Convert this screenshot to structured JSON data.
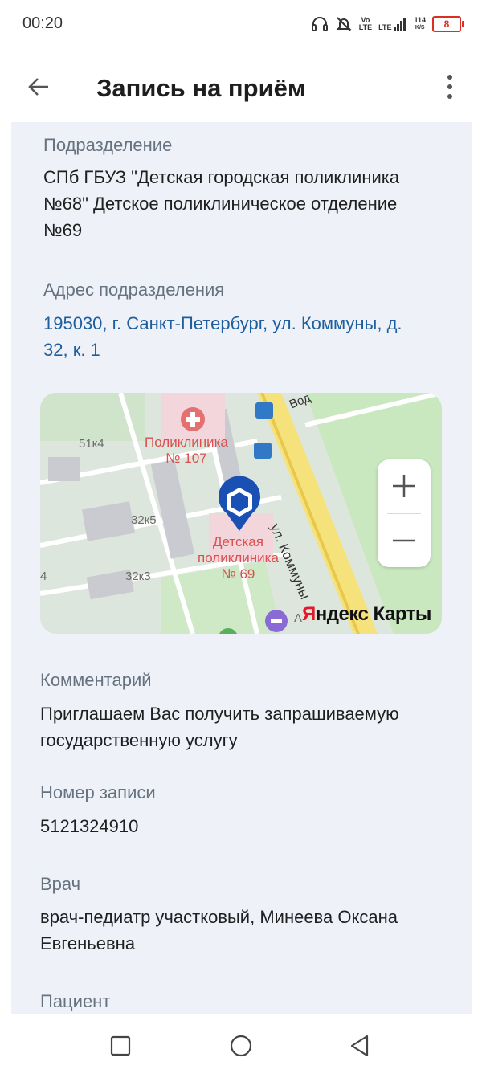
{
  "status_bar": {
    "time": "00:20",
    "net_vo": "Vo",
    "net_lte_top": "LTE",
    "net_lte_1": "LTE",
    "speed_value": "114",
    "speed_unit": "K/S",
    "battery": "8"
  },
  "app_bar": {
    "title": "Запись на приём"
  },
  "details": {
    "division_label": "Подразделение",
    "division_value_lines": [
      "СПб ГБУЗ \"Детская городская поликлиника",
      "№68\" Детское поликлиническое отделение",
      "№69"
    ],
    "address_label": "Адрес подразделения",
    "address_lines": [
      "195030, г. Санкт-Петербург, ул. Коммуны, д.",
      "32, к. 1"
    ],
    "comment_label": "Комментарий",
    "comment_lines": [
      "Приглашаем Вас получить запрашиваемую",
      "государственную услугу"
    ],
    "record_label": "Номер записи",
    "record_value": "5121324910",
    "doctor_label": "Врач",
    "doctor_lines": [
      "врач-педиатр участковый, Минеева Оксана",
      "Евгеньевна"
    ],
    "patient_label": "Пациент"
  },
  "map": {
    "labels": {
      "house_51k4": "51к4",
      "poly107_line1": "Поликлиника",
      "poly107_line2": "№ 107",
      "house_32k5": "32к5",
      "house_32k3": "32к3",
      "kids_line1": "Детская",
      "kids_line2": "поликлиника",
      "kids_line3": "№ 69",
      "street_kommuny": "ул. Коммуны",
      "street_vod": "Вод",
      "edge_4": "4",
      "edge_a": "А"
    },
    "logo_y": "Я",
    "logo_rest": "ндекс Карты",
    "colors": {
      "pin": "#1a4fb4",
      "road_yellow": "#f6e27a",
      "medical_red": "#e4706f",
      "park_green": "#c9e8c0"
    }
  },
  "icons": {
    "back": "arrow-left-icon",
    "menu": "more-vert-icon",
    "zoom_in": "plus-icon",
    "zoom_out": "minus-icon",
    "nav_recent": "square-icon",
    "nav_home": "circle-icon",
    "nav_back": "triangle-back-icon"
  },
  "colors": {
    "card_bg": "#eef2f8",
    "link": "#1f5e9e",
    "label": "#66727f"
  }
}
